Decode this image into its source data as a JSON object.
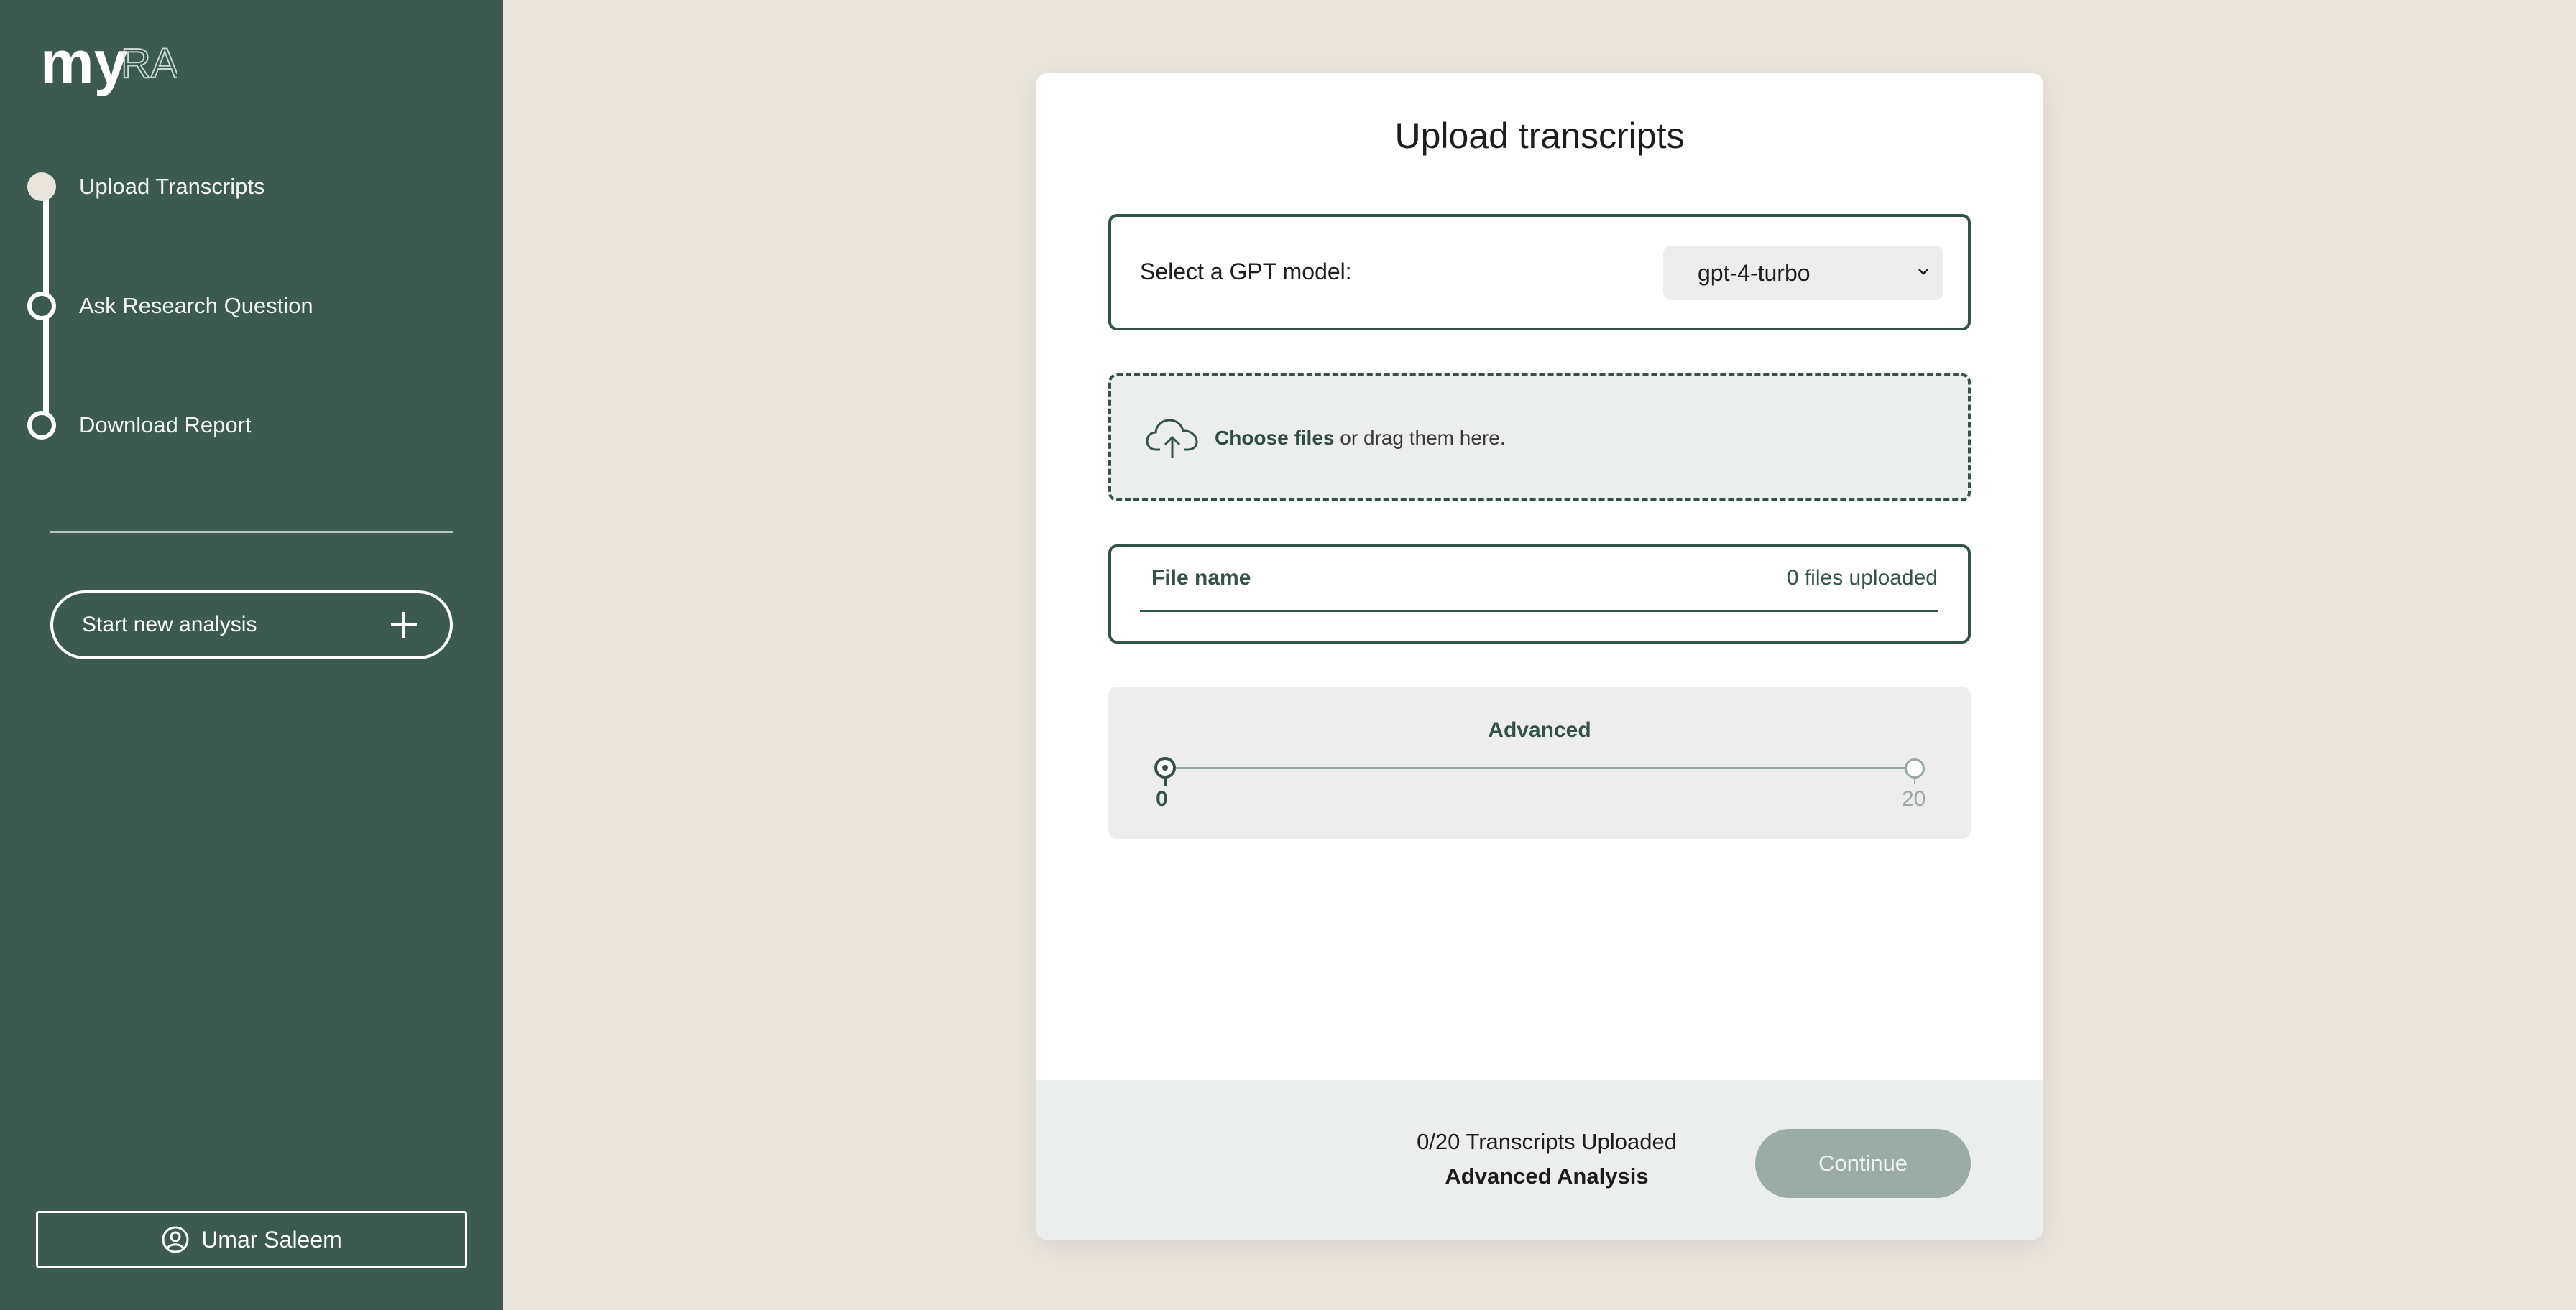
{
  "brand": {
    "logo_text": "myRA",
    "accent": "#3c5a50",
    "background": "#e9e4dc"
  },
  "sidebar": {
    "steps": [
      {
        "label": "Upload Transcripts",
        "state": "active"
      },
      {
        "label": "Ask Research Question",
        "state": "inactive"
      },
      {
        "label": "Download Report",
        "state": "inactive"
      }
    ],
    "new_analysis_label": "Start new analysis",
    "user_name": "Umar Saleem"
  },
  "main": {
    "title": "Upload transcripts",
    "model": {
      "label": "Select a GPT model:",
      "selected": "gpt-4-turbo"
    },
    "dropzone": {
      "link_text": "Choose files",
      "rest_text": " or drag them here."
    },
    "file_list": {
      "header": "File name",
      "count_text": "0 files uploaded"
    },
    "advanced": {
      "title": "Advanced",
      "slider_value": 0,
      "slider_min_label": "0",
      "slider_max_label": "20"
    },
    "footer": {
      "status_text": "0/20 Transcripts Uploaded",
      "mode_text": "Advanced Analysis",
      "continue_label": "Continue",
      "continue_enabled": false
    }
  }
}
